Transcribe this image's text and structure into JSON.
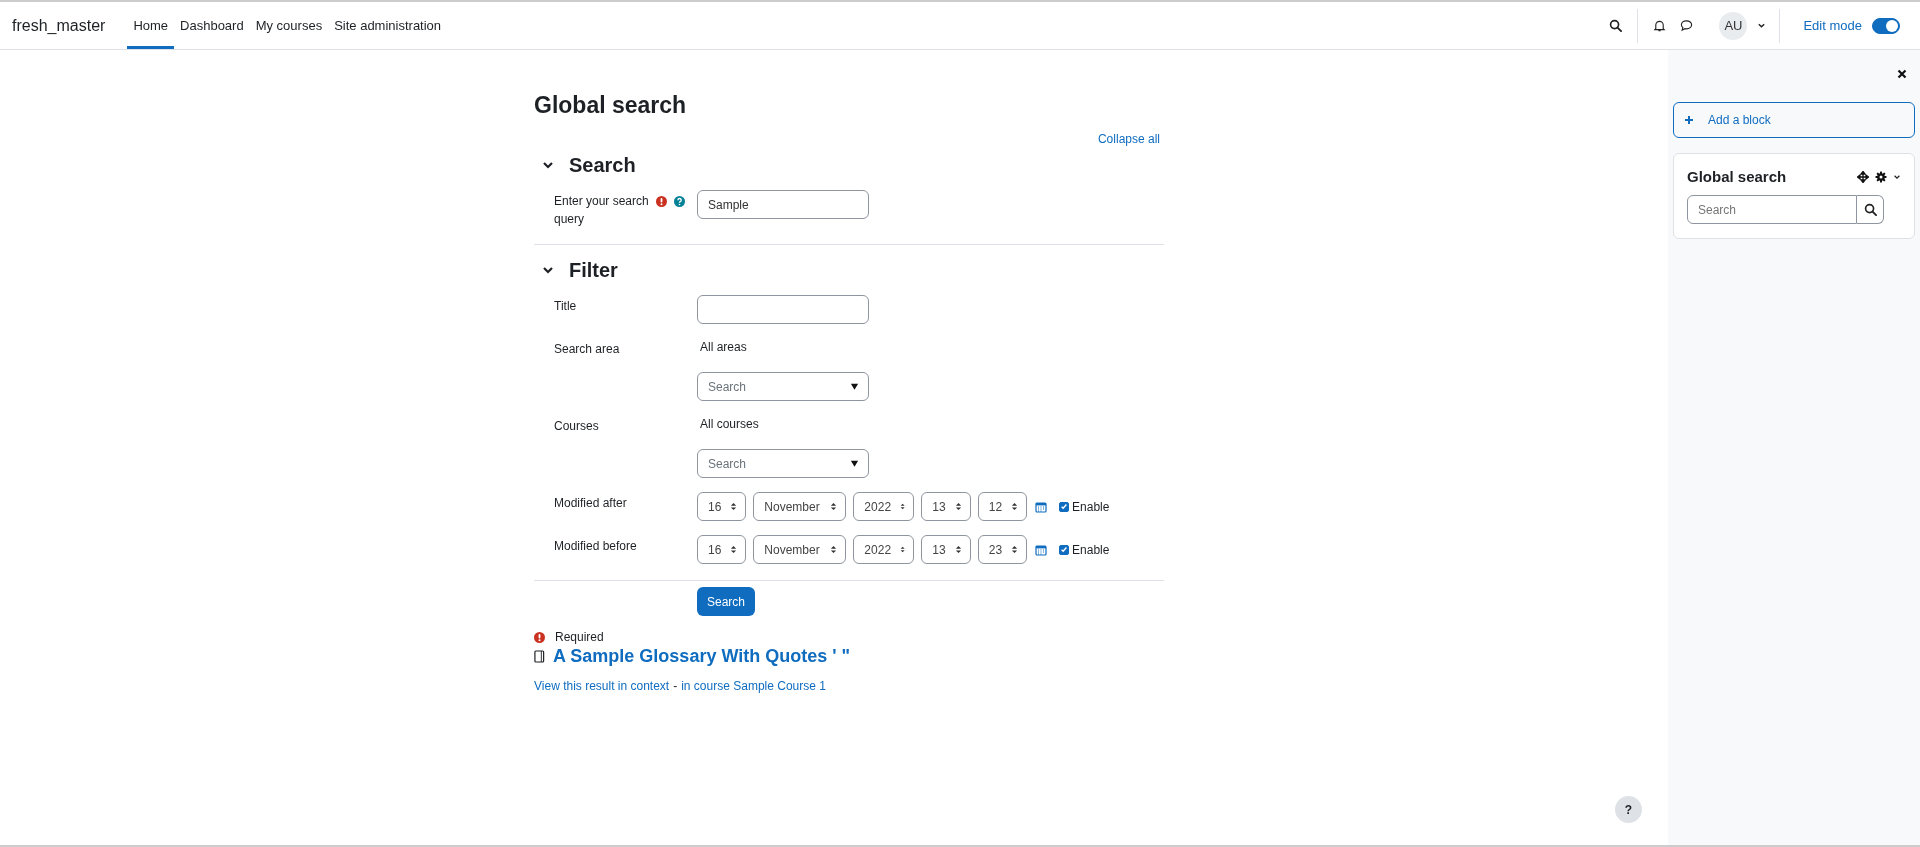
{
  "navbar": {
    "site_name": "fresh_master",
    "items": [
      {
        "label": "Home",
        "selected": true
      },
      {
        "label": "Dashboard",
        "selected": false
      },
      {
        "label": "My courses",
        "selected": false
      },
      {
        "label": "Site administration",
        "selected": false
      }
    ],
    "avatar": "AU",
    "edit_mode": {
      "label": "Edit mode",
      "on": true
    }
  },
  "page": {
    "title": "Global search",
    "collapse_all": "Collapse all",
    "sections": [
      {
        "title": "Search",
        "expanded": true,
        "fields": [
          {
            "kind": "text",
            "label": "Enter your search query",
            "required": true,
            "help": true,
            "value": "Sample"
          }
        ]
      },
      {
        "title": "Filter",
        "expanded": true,
        "fields": [
          {
            "kind": "text",
            "label": "Title"
          },
          {
            "kind": "autocomplete",
            "label": "Search area",
            "selection": "All areas",
            "placeholder": "Search"
          },
          {
            "kind": "autocomplete",
            "label": "Courses",
            "selection": "All courses",
            "placeholder": "Search"
          },
          {
            "kind": "date",
            "label": "Modified after",
            "parts": [
              "16",
              "November",
              "2022",
              "13",
              "12"
            ],
            "enable_label": "Enable",
            "checked": true
          },
          {
            "kind": "date",
            "label": "Modified before",
            "parts": [
              "16",
              "November",
              "2022",
              "13",
              "23"
            ],
            "enable_label": "Enable",
            "checked": true
          }
        ]
      }
    ],
    "submit": "Search",
    "required_note": "Required",
    "results": [
      {
        "title": "A Sample Glossary With Quotes ' \"",
        "context_link": "View this result in context",
        "separator": "-",
        "course_link": "in course Sample Course 1"
      }
    ]
  },
  "help_button": "?",
  "drawer": {
    "add_block": "Add a block",
    "block": {
      "title": "Global search",
      "search_placeholder": "Search"
    }
  }
}
